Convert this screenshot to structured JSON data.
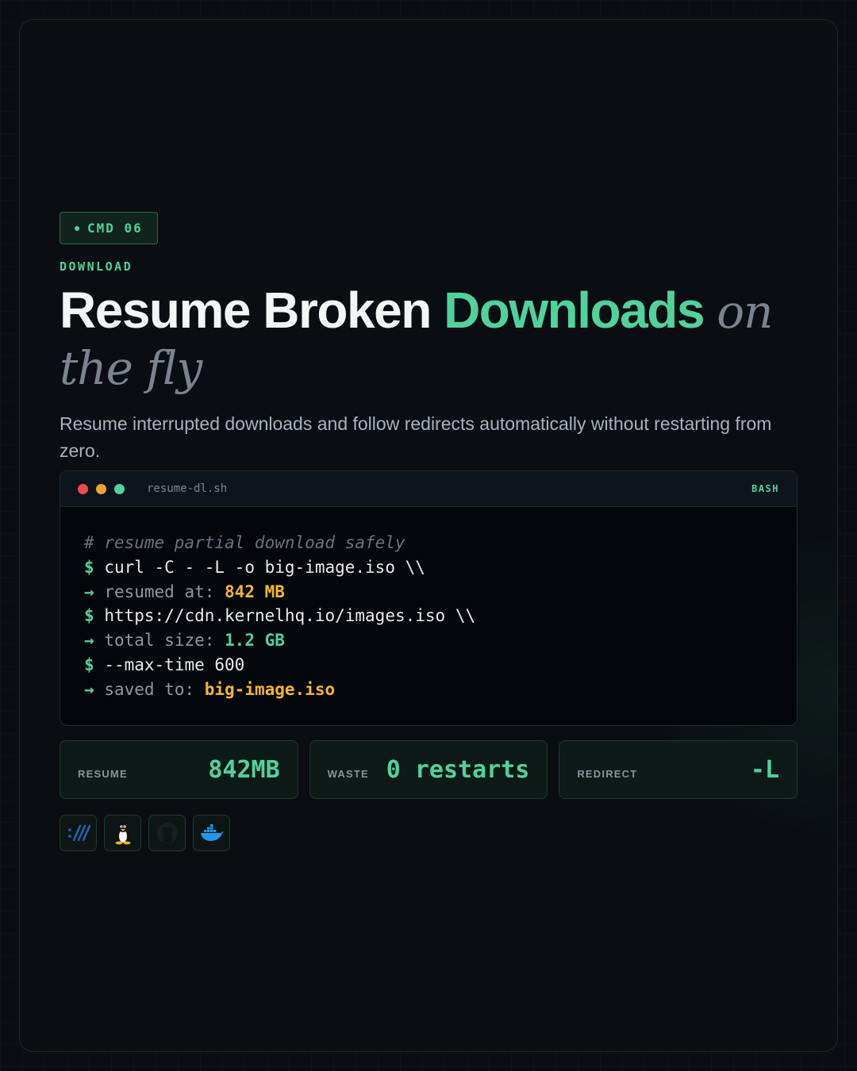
{
  "badge": {
    "label": "CMD 06"
  },
  "category": "DOWNLOAD",
  "headline": {
    "part1": "Resume Broken",
    "accent": "Downloads",
    "soft1": "on",
    "soft2": "the fly"
  },
  "subtitle": "Resume interrupted downloads and follow redirects automatically without restarting from zero.",
  "terminal": {
    "filename": "resume-dl.sh",
    "language": "BASH",
    "lines": {
      "comment": "# resume partial download safely",
      "cmd1": "curl -C - -L -o big-image.iso \\\\",
      "out1_label": "resumed at: ",
      "out1_value": "842 MB",
      "cmd2": "https://cdn.kernelhq.io/images.iso \\\\",
      "out2_label": "total size: ",
      "out2_value": "1.2 GB",
      "cmd3": "--max-time 600",
      "out3_label": "saved to: ",
      "out3_value": "big-image.iso"
    },
    "prompt_symbol": "$",
    "arrow_symbol": "→"
  },
  "stats": [
    {
      "label": "RESUME",
      "value": "842MB"
    },
    {
      "label": "WASTE",
      "value": "0 restarts"
    },
    {
      "label": "REDIRECT",
      "value": "-L"
    }
  ],
  "icons": [
    "curl-icon",
    "linux-tux-icon",
    "github-icon",
    "docker-icon"
  ],
  "colors": {
    "accent": "#4fd39a",
    "amber": "#f3b72c",
    "background": "#0a0d12"
  }
}
